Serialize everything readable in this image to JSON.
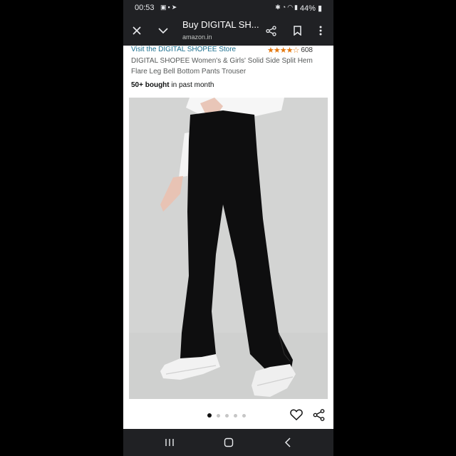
{
  "status_bar": {
    "time": "00:53",
    "left_icons": [
      "image-icon",
      "linkedin-icon",
      "telegram-icon"
    ],
    "right_icons": [
      "bluetooth-icon",
      "alarm-icon",
      "wifi-icon",
      "signal-icon"
    ],
    "battery": "44%"
  },
  "toolbar": {
    "title": "Buy DIGITAL SH...",
    "url": "amazon.in"
  },
  "product": {
    "store_link": "Visit the DIGITAL SHOPEE Store",
    "rating_stars": "★★★★☆",
    "rating_value": 3.5,
    "rating_count": "608",
    "title": "DIGITAL SHOPEE Women's & Girls' Solid Side Split Hem Flare Leg Bell Bottom Pants Trouser",
    "bought_bold": "50+ bought",
    "bought_rest": " in past month"
  },
  "carousel": {
    "total": 5,
    "active_index": 0
  },
  "colors": {
    "status_bg": "#202124",
    "link": "#1a6f8f",
    "star": "#e47911",
    "image_bg": "#d3d4d3"
  }
}
